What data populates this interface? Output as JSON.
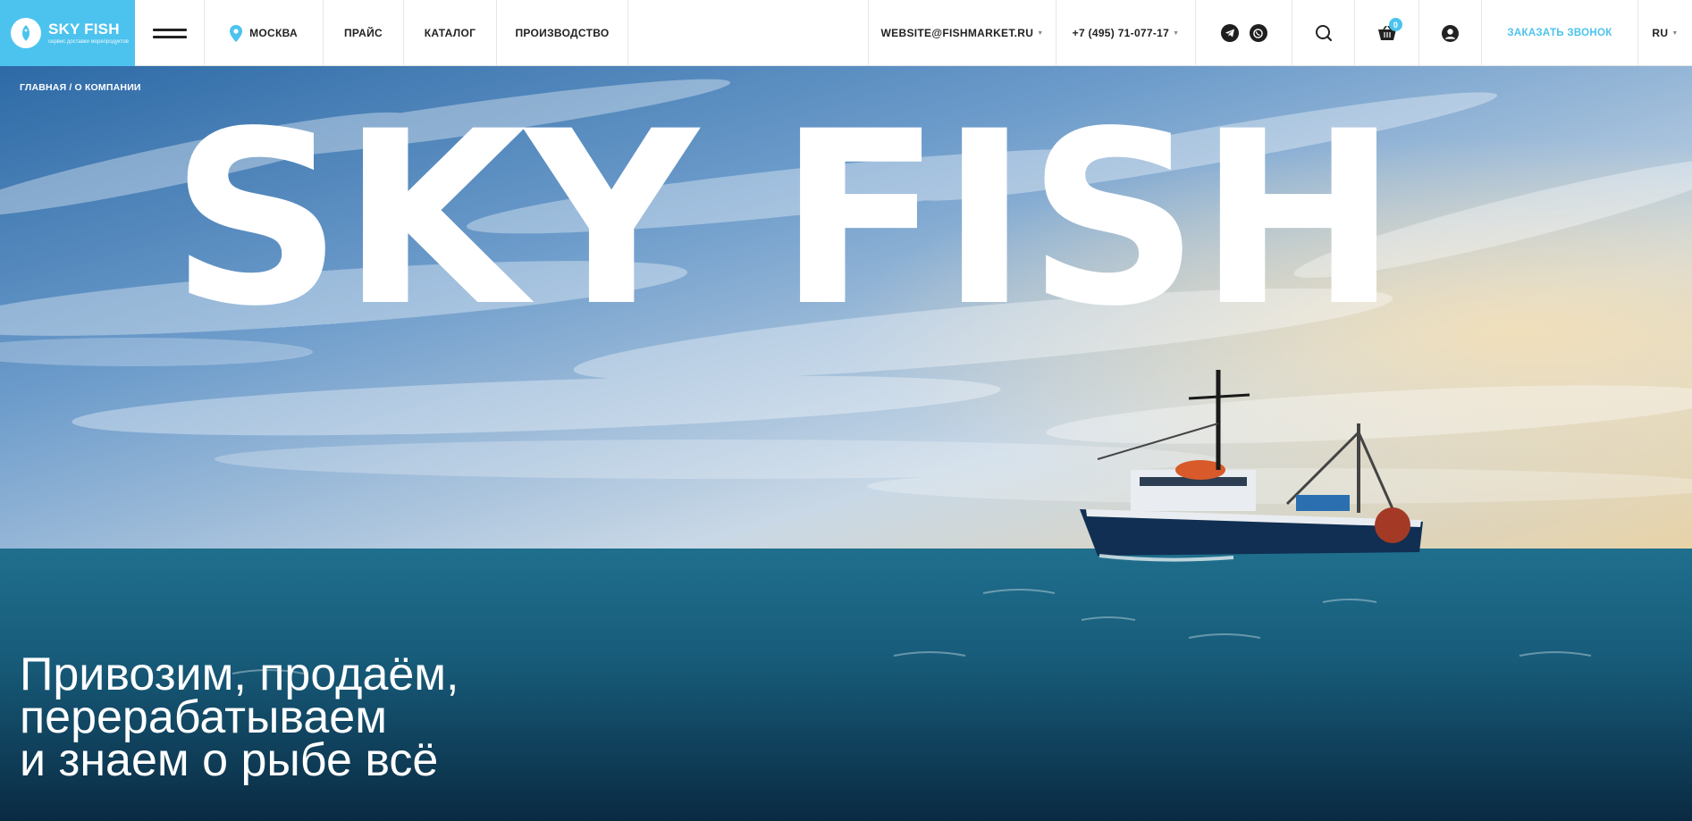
{
  "header": {
    "logo": {
      "title": "SKY FISH",
      "subtitle": "сервис доставки морепродуктов"
    },
    "city": "МОСКВА",
    "nav": [
      "ПРАЙС",
      "КАТАЛОГ",
      "ПРОИЗВОДСТВО"
    ],
    "email": "WEBSITE@FISHMARKET.RU",
    "phone": "+7 (495) 71-077-17",
    "cart_count": "0",
    "callback_label": "ЗАКАЗАТЬ ЗВОНОК",
    "language": "RU"
  },
  "breadcrumb": {
    "home": "ГЛАВНАЯ",
    "separator": "/",
    "current": "О КОМПАНИИ"
  },
  "hero": {
    "title": "SKY FISH",
    "tagline": [
      "Привозим, продаём,",
      "перерабатываем",
      "и знаем о рыбе всё"
    ]
  },
  "colors": {
    "accent": "#4cc3ee",
    "header_bg": "#ffffff",
    "text_dark": "#222222"
  },
  "icons": [
    "burger-menu-icon",
    "location-pin-icon",
    "telegram-icon",
    "whatsapp-icon",
    "search-icon",
    "cart-icon",
    "user-icon"
  ]
}
